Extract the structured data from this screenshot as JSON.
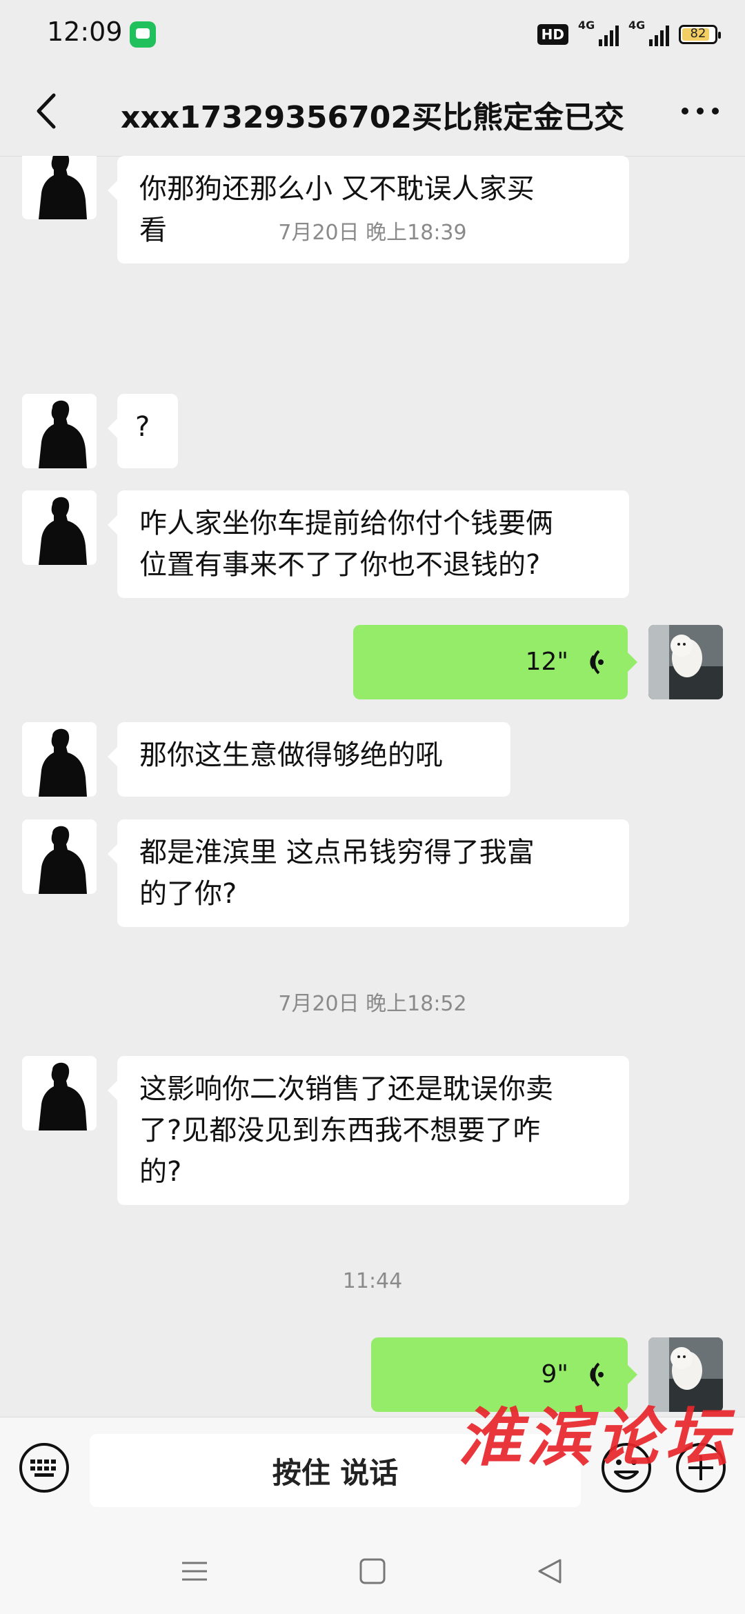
{
  "status_bar": {
    "time": "12:09",
    "hd_label": "HD",
    "network_1": "4G",
    "network_2": "4G",
    "battery": "82"
  },
  "header": {
    "title": "xxx17329356702买比熊定金已交"
  },
  "messages": [
    {
      "type": "text",
      "side": "left",
      "lines": [
        "你那狗还那么小  又不耽误人家买",
        "看"
      ]
    },
    {
      "type": "time",
      "text": "7月20日 晚上18:39"
    },
    {
      "type": "text",
      "side": "left",
      "lines": [
        "?"
      ]
    },
    {
      "type": "text",
      "side": "left",
      "lines": [
        "咋人家坐你车提前给你付个钱要俩",
        "位置有事来不了了你也不退钱的?"
      ]
    },
    {
      "type": "voice",
      "side": "right",
      "duration": "12\""
    },
    {
      "type": "text",
      "side": "left",
      "lines": [
        "那你这生意做得够绝的吼"
      ]
    },
    {
      "type": "text",
      "side": "left",
      "lines": [
        "都是淮滨里  这点吊钱穷得了我富",
        "的了你?"
      ]
    },
    {
      "type": "time",
      "text": "7月20日 晚上18:52"
    },
    {
      "type": "text",
      "side": "left",
      "lines": [
        "这影响你二次销售了还是耽误你卖",
        "了?见都没见到东西我不想要了咋",
        "的?"
      ]
    },
    {
      "type": "time",
      "text": "11:44"
    },
    {
      "type": "voice",
      "side": "right",
      "duration": "9\""
    }
  ],
  "input_bar": {
    "talk_label": "按住 说话"
  },
  "watermark": "淮滨论坛",
  "colors": {
    "background": "#ededed",
    "voice_bubble": "#95ec69",
    "text_bubble": "#ffffff",
    "watermark": "#e8262c"
  },
  "icons": [
    "back-arrow-icon",
    "more-dots-icon",
    "keyboard-icon",
    "emoji-icon",
    "plus-icon",
    "voice-wave-icon",
    "menu-icon",
    "home-icon",
    "back-triangle-icon"
  ]
}
